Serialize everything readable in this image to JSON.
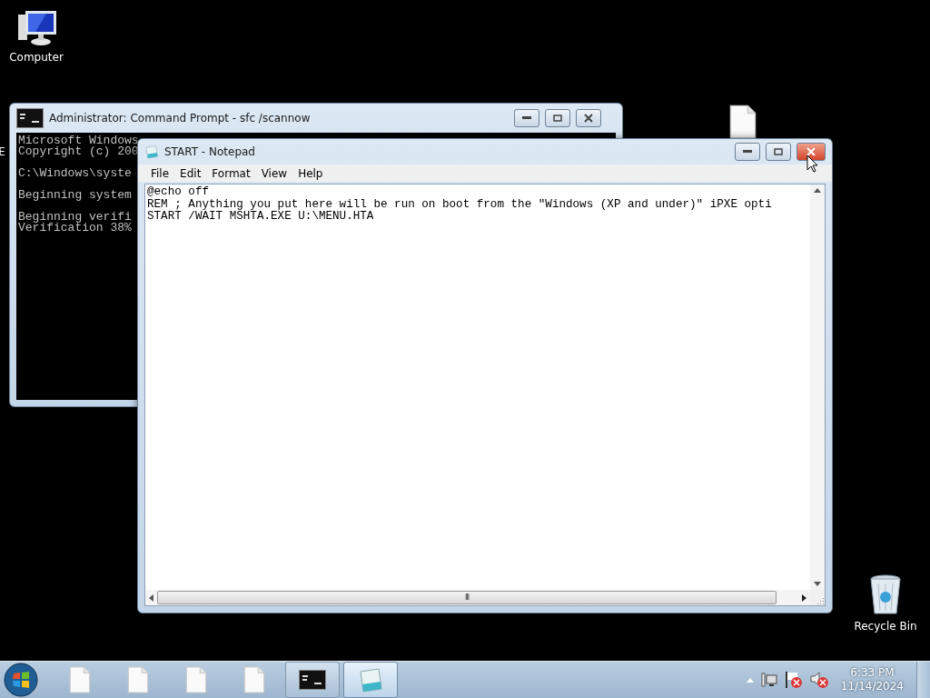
{
  "desktop_icons": [
    {
      "kind": "computer",
      "label": "Computer"
    },
    {
      "kind": "fragment",
      "label": "E"
    },
    {
      "kind": "file"
    },
    {
      "kind": "recycle_bin",
      "label": "Recycle Bin"
    }
  ],
  "console_window": {
    "title": "Administrator:  Command Prompt - sfc  /scannow",
    "paragraphs": [
      [
        "Microsoft Windows",
        "Copyright (c) 200"
      ],
      [
        "C:\\Windows\\syste"
      ],
      [
        "Beginning system"
      ],
      [
        "Beginning verifi",
        "Verification 38%"
      ]
    ]
  },
  "notepad_window": {
    "title": "START - Notepad",
    "close_hovered": true,
    "menu": [
      "File",
      "Edit",
      "Format",
      "View",
      "Help"
    ],
    "lines": [
      "@echo off",
      "REM ; Anything you put here will be run on boot from the \"Windows (XP and under)\" iPXE opti",
      "START /WAIT MSHTA.EXE U:\\MENU.HTA"
    ],
    "scrollbar_grip": "III"
  },
  "taskbar": {
    "items": [
      {
        "kind": "file",
        "selected": false
      },
      {
        "kind": "file",
        "selected": false
      },
      {
        "kind": "file",
        "selected": false
      },
      {
        "kind": "file",
        "selected": false
      },
      {
        "kind": "console",
        "selected": false
      },
      {
        "kind": "notepad",
        "selected": true
      }
    ],
    "tray": [
      {
        "kind": "expand"
      },
      {
        "kind": "network"
      },
      {
        "kind": "flag_error"
      },
      {
        "kind": "speaker_muted"
      }
    ],
    "time": "6:33 PM",
    "date": "11/14/2024"
  }
}
